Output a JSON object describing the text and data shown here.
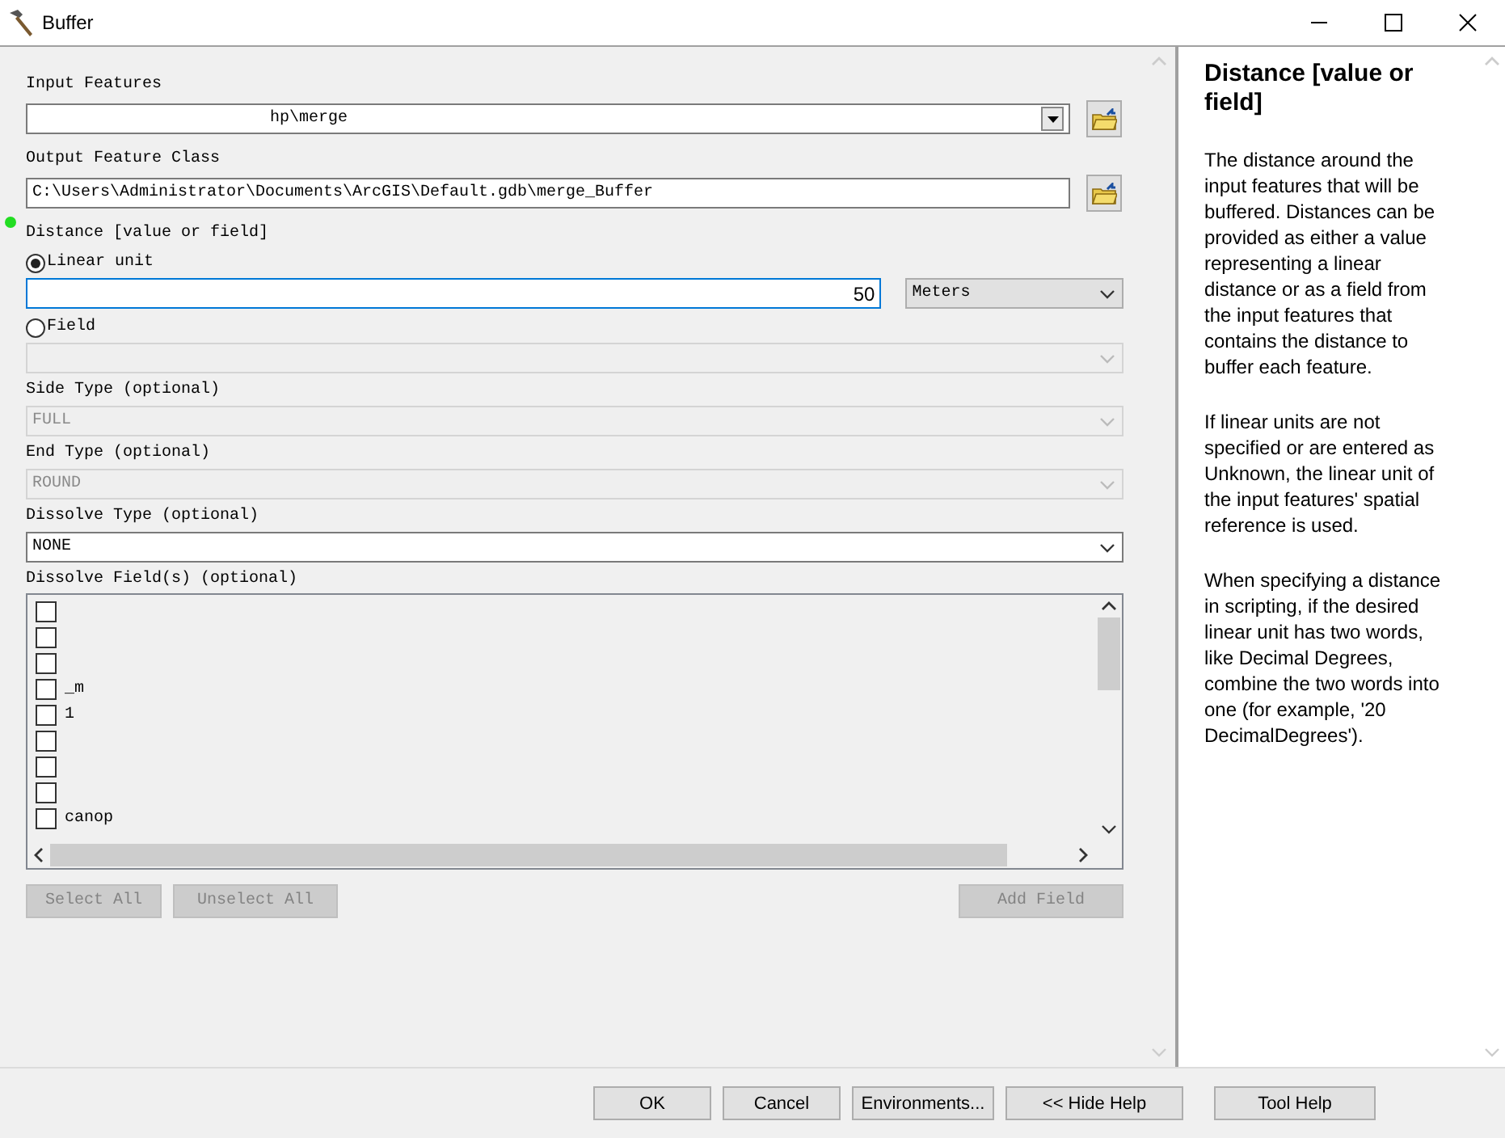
{
  "window": {
    "title": "Buffer"
  },
  "input_features": {
    "label": "Input Features",
    "value": "hp\\merge"
  },
  "output_feature_class": {
    "label": "Output Feature Class",
    "value": "C:\\Users\\Administrator\\Documents\\ArcGIS\\Default.gdb\\merge_Buffer"
  },
  "distance": {
    "label": "Distance [value or field]",
    "required": true,
    "options": [
      {
        "label": "Linear unit",
        "selected": true
      },
      {
        "label": "Field",
        "selected": false
      }
    ],
    "value": "50",
    "unit": "Meters"
  },
  "side_type": {
    "label": "Side Type (optional)",
    "value": "FULL",
    "disabled": true
  },
  "end_type": {
    "label": "End Type (optional)",
    "value": "ROUND",
    "disabled": true
  },
  "dissolve_type": {
    "label": "Dissolve Type (optional)",
    "value": "NONE",
    "disabled": false
  },
  "dissolve_fields": {
    "label": "Dissolve Field(s) (optional)",
    "items": [
      {
        "checked": false
      },
      {
        "checked": false
      },
      {
        "checked": false
      },
      {
        "checked": false,
        "label": "_m"
      },
      {
        "checked": false,
        "label": "1"
      },
      {
        "checked": false
      },
      {
        "checked": false
      },
      {
        "checked": false
      },
      {
        "checked": false,
        "label": "canop"
      }
    ],
    "buttons": [
      {
        "label": "Select All",
        "disabled": true
      },
      {
        "label": "Unselect All",
        "disabled": true
      },
      {
        "label": "Add Field",
        "disabled": true
      }
    ]
  },
  "help": {
    "title": "Distance [value or field]",
    "paragraphs": [
      "The distance around the input features that will be buffered. Distances can be provided as either a value representing a linear distance or as a field from the input features that contains the distance to buffer each feature.",
      "If linear units are not specified or are entered as Unknown, the linear unit of the input features' spatial reference is used.",
      "When specifying a distance in scripting, if the desired linear unit has two words, like Decimal Degrees, combine the two words into one (for example, '20 DecimalDegrees')."
    ]
  },
  "footer_buttons": [
    "OK",
    "Cancel",
    "Environments...",
    "<< Hide Help",
    "Tool Help"
  ]
}
